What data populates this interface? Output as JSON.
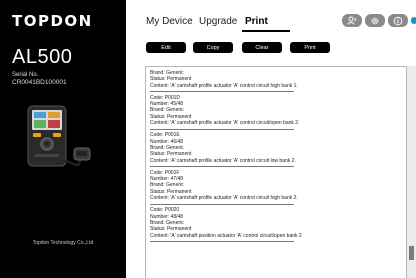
{
  "sidebar": {
    "brand": "TOPDON",
    "model": "AL500",
    "serial_label": "Serial No.",
    "serial_value": "CR0041BD100001",
    "company": "Topdon Technology Co.,Ltd"
  },
  "tabs": [
    {
      "label": "My Device"
    },
    {
      "label": "Upgrade"
    },
    {
      "label": "Print"
    }
  ],
  "active_tab": "Print",
  "toolbar": {
    "edit": "Edit",
    "copy": "Copy",
    "clear": "Clear",
    "print": "Print"
  },
  "top_icons": [
    "user-icon",
    "settings-icon",
    "info-icon"
  ],
  "accent_color": "#1c8fd1",
  "entries": [
    {
      "lines": [
        "Brand: Generic",
        "Status: Permanent",
        "Content: 'A' camshaft profile actuator 'A' control circuit high bank 1."
      ]
    },
    {
      "lines": [
        "Code: P001D",
        "Number: 45/48",
        "Brand: Generic",
        "Status: Permanent",
        "Content: 'A' camshaft profile actuator 'A' control circuit/open bank 2."
      ]
    },
    {
      "lines": [
        "Code: P001E",
        "Number: 46/48",
        "Brand: Generic",
        "Status: Permanent",
        "Content: 'A' camshaft profile actuator 'A' control circuit low bank 2."
      ]
    },
    {
      "lines": [
        "Code: P001F",
        "Number: 47/48",
        "Brand: Generic",
        "Status: Permanent",
        "Content: 'A' camshaft profile actuator 'A' control circuit high bank 2."
      ]
    },
    {
      "lines": [
        "Code: P0020",
        "Number: 48/48",
        "Brand: Generic",
        "Status: Permanent",
        "Content: 'A' camshaft position actuator 'A' control circuit/open bank 2."
      ]
    }
  ]
}
